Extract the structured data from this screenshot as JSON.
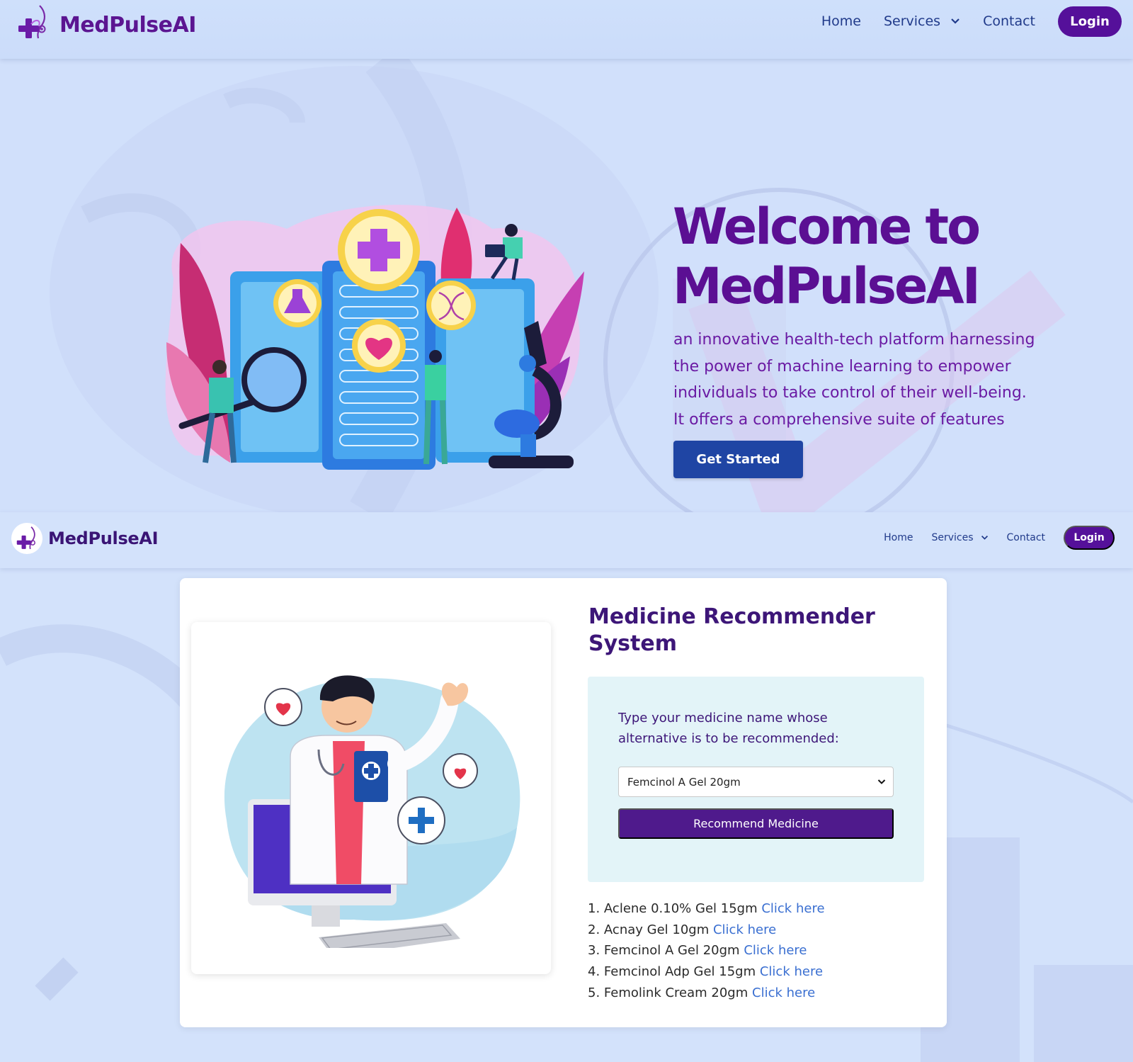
{
  "header": {
    "brand": "MedPulseAI",
    "nav": [
      {
        "label": "Home"
      },
      {
        "label": "Services",
        "icon": "chevron-down-icon"
      },
      {
        "label": "Contact"
      }
    ],
    "login_label": "Login"
  },
  "hero": {
    "title_line1": "Welcome to",
    "title_line2": "MedPulseAI",
    "description": "an innovative health-tech platform harnessing the power of machine learning to empower individuals to take control of their well-being. It offers a comprehensive suite of features",
    "cta_label": "Get Started"
  },
  "header2": {
    "brand": "MedPulseAI",
    "nav": [
      {
        "label": "Home"
      },
      {
        "label": "Services",
        "icon": "chevron-down-icon"
      },
      {
        "label": "Contact"
      }
    ],
    "login_label": "Login"
  },
  "recommender": {
    "title": "Medicine Recommender System",
    "prompt": "Type your medicine name whose alternative is to be recommended:",
    "selected_medicine": "Femcinol A Gel 20gm",
    "button_label": "Recommend Medicine",
    "link_text": "Click here",
    "results": [
      {
        "index": "1.",
        "name": "Aclene 0.10% Gel 15gm"
      },
      {
        "index": "2.",
        "name": "Acnay Gel 10gm"
      },
      {
        "index": "3.",
        "name": "Femcinol A Gel 20gm"
      },
      {
        "index": "4.",
        "name": "Femcinol Adp Gel 15gm"
      },
      {
        "index": "5.",
        "name": "Femolink Cream 20gm"
      }
    ]
  },
  "colors": {
    "brand_purple": "#5b1591",
    "nav_blue": "#203a8a",
    "cta_blue": "#1f45a4",
    "recommend_purple": "#4f1a8c",
    "link_blue": "#3a6fd1"
  }
}
